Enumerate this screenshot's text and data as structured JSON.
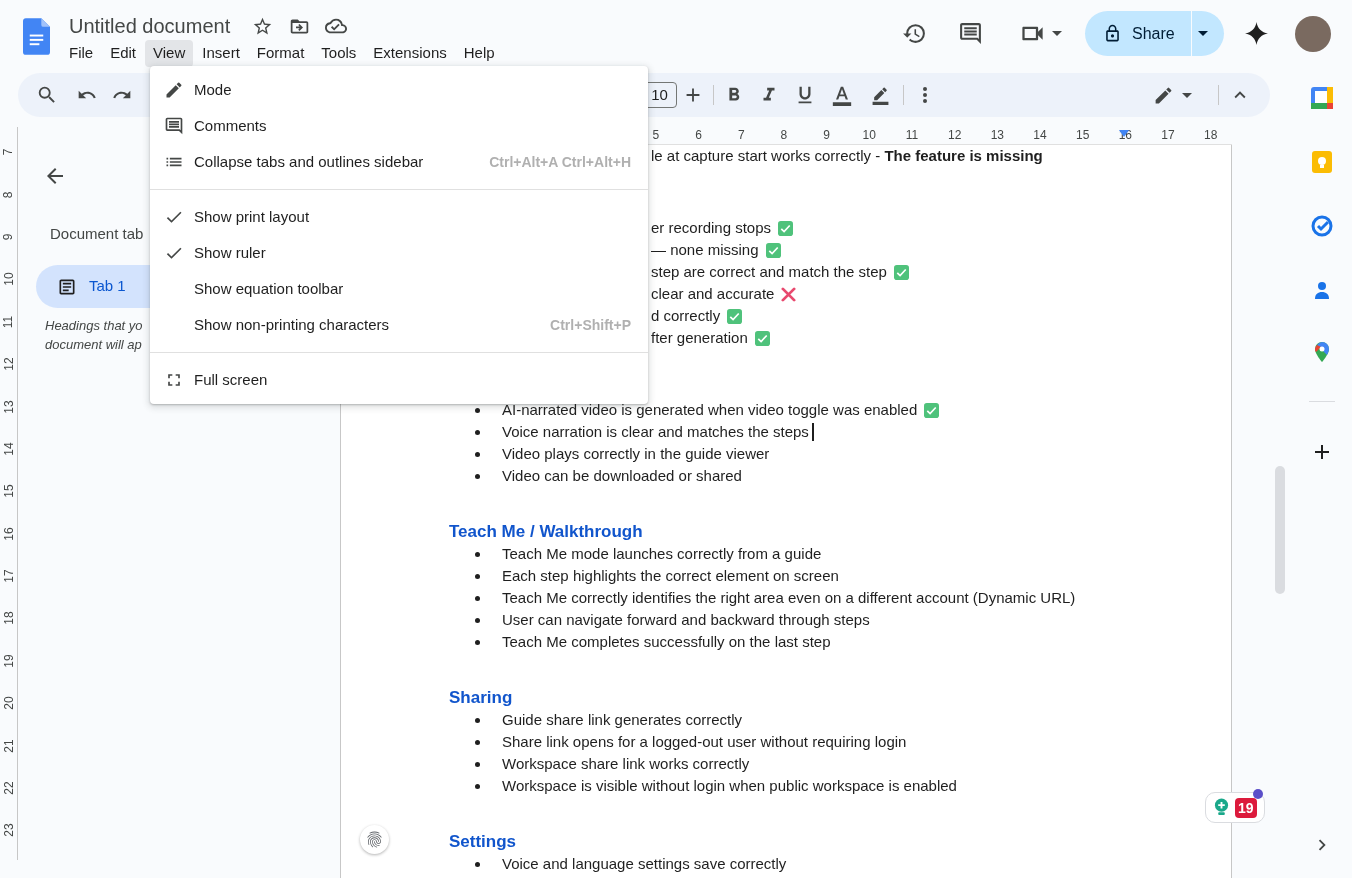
{
  "app": {
    "title": "Untitled document",
    "menus": [
      {
        "label": "File",
        "selected": false
      },
      {
        "label": "Edit",
        "selected": false
      },
      {
        "label": "View",
        "selected": true
      },
      {
        "label": "Insert",
        "selected": false
      },
      {
        "label": "Format",
        "selected": false
      },
      {
        "label": "Tools",
        "selected": false
      },
      {
        "label": "Extensions",
        "selected": false
      },
      {
        "label": "Help",
        "selected": false
      }
    ]
  },
  "header": {
    "share_label": "Share"
  },
  "toolbar": {
    "font_size": "10"
  },
  "ruler": {
    "h_numbers": [
      "5",
      "6",
      "7",
      "8",
      "9",
      "10",
      "11",
      "12",
      "13",
      "14",
      "15",
      "16",
      "17",
      "18"
    ],
    "v_numbers": [
      "7",
      "8",
      "9",
      "10",
      "11",
      "12",
      "13",
      "14",
      "15",
      "16",
      "17",
      "18",
      "19",
      "20",
      "21",
      "22",
      "23"
    ]
  },
  "sidebar": {
    "heading": "Document tab",
    "tabs": [
      {
        "label": "Tab 1",
        "selected": true
      }
    ],
    "hint_lines": [
      "Headings that yo",
      "document will ap"
    ]
  },
  "document": {
    "sections": [
      {
        "items": [
          {
            "kind": "partial",
            "text": "le at capture start works correctly - **The feature is missing**"
          }
        ]
      },
      {
        "items": [
          {
            "kind": "partial",
            "text": "er recording stops",
            "passed": true
          },
          {
            "kind": "partial",
            "text": "— none missing",
            "passed": true
          },
          {
            "kind": "partial",
            "text": "step are correct and match the step",
            "passed": true
          },
          {
            "kind": "partial",
            "text": "clear and accurate",
            "passed": false
          },
          {
            "kind": "partial",
            "text": "d correctly",
            "passed": true
          },
          {
            "kind": "partial",
            "text": "fter generation",
            "passed": true
          }
        ]
      },
      {
        "items": [
          {
            "kind": "bullet",
            "text": "AI-narrated video is generated when video toggle was enabled",
            "passed": true
          },
          {
            "kind": "bullet",
            "text": "Voice narration is clear and matches the steps",
            "cursor": true
          },
          {
            "kind": "bullet",
            "text": "Video plays correctly in the guide viewer"
          },
          {
            "kind": "bullet",
            "text": "Video can be downloaded or shared"
          }
        ]
      },
      {
        "heading": "Teach Me / Walkthrough",
        "items": [
          {
            "kind": "bullet",
            "text": "Teach Me mode launches correctly from a guide"
          },
          {
            "kind": "bullet",
            "text": "Each step highlights the correct element on screen"
          },
          {
            "kind": "bullet",
            "text": "Teach Me correctly identifies the right area even on a different account (Dynamic URL)"
          },
          {
            "kind": "bullet",
            "text": "User can navigate forward and backward through steps"
          },
          {
            "kind": "bullet",
            "text": "Teach Me completes successfully on the last step"
          }
        ]
      },
      {
        "heading": "Sharing",
        "items": [
          {
            "kind": "bullet",
            "text": "Guide share link generates correctly"
          },
          {
            "kind": "bullet",
            "text": "Share link opens for a logged-out user without requiring login"
          },
          {
            "kind": "bullet",
            "text": "Workspace share link works correctly"
          },
          {
            "kind": "bullet",
            "text": "Workspace is visible without login when public workspace is enabled"
          }
        ]
      },
      {
        "heading": "Settings",
        "items": [
          {
            "kind": "bullet",
            "text": "Voice and language settings save correctly"
          }
        ]
      }
    ]
  },
  "view_menu": {
    "groups": [
      [
        {
          "kind": "pencil",
          "label": "Mode"
        },
        {
          "kind": "comments",
          "label": "Comments"
        },
        {
          "kind": "list",
          "label": "Collapse tabs and outlines sidebar",
          "shortcut": "Ctrl+Alt+A Ctrl+Alt+H"
        }
      ],
      [
        {
          "kind": "toggle",
          "label": "Show print layout",
          "checked": true
        },
        {
          "kind": "toggle",
          "label": "Show ruler",
          "checked": true
        },
        {
          "kind": "toggle",
          "label": "Show equation toolbar",
          "checked": false
        },
        {
          "kind": "toggle",
          "label": "Show non-printing characters",
          "checked": false,
          "shortcut": "Ctrl+Shift+P"
        }
      ],
      [
        {
          "kind": "fullscreen",
          "label": "Full screen"
        }
      ]
    ]
  },
  "addon_badge": {
    "count": "19"
  }
}
